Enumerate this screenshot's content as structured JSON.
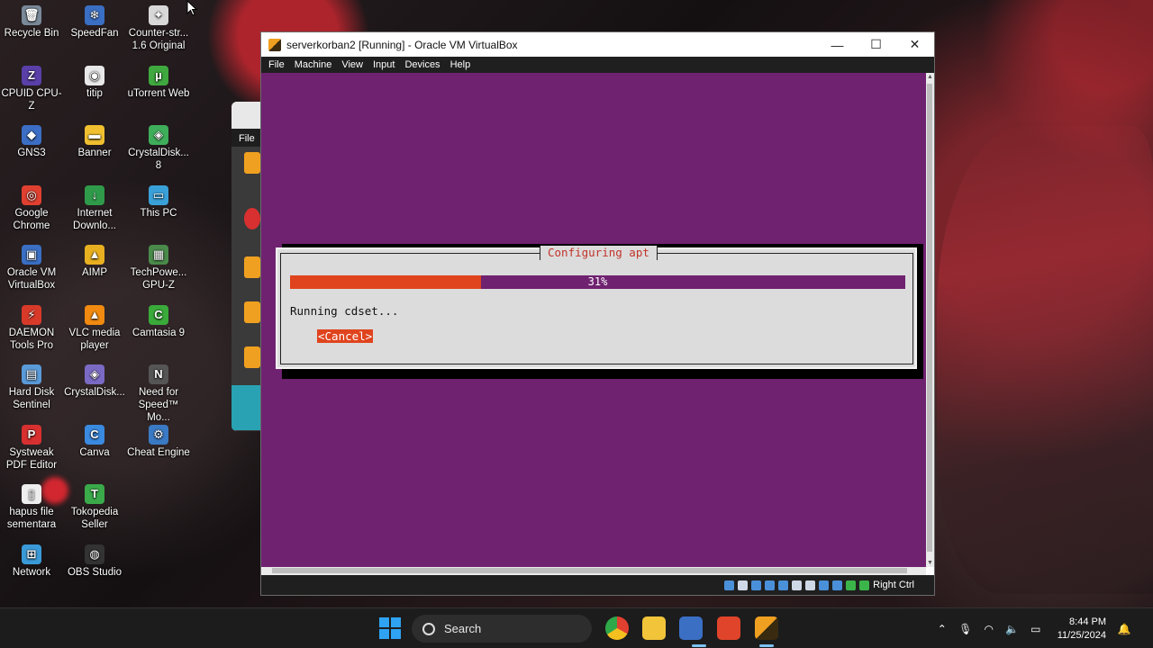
{
  "desktop": {
    "icons": [
      {
        "label": "Recycle Bin",
        "color": "#7a8a99",
        "glyph": "🗑"
      },
      {
        "label": "SpeedFan",
        "color": "#3a6fc4",
        "glyph": "❄"
      },
      {
        "label": "Counter-str... 1.6 Original",
        "color": "#d8d8d8",
        "glyph": "✦"
      },
      {
        "label": "CPUID CPU-Z",
        "color": "#5a3fa8",
        "glyph": "Z"
      },
      {
        "label": "titip",
        "color": "#e8e8e8",
        "glyph": "◉"
      },
      {
        "label": "uTorrent Web",
        "color": "#3fa83f",
        "glyph": "µ"
      },
      {
        "label": "GNS3",
        "color": "#3b6ec4",
        "glyph": "◆"
      },
      {
        "label": "Banner",
        "color": "#f0c030",
        "glyph": "▬"
      },
      {
        "label": "CrystalDisk... 8",
        "color": "#3fae5a",
        "glyph": "◈"
      },
      {
        "label": "Google Chrome",
        "color": "#e04030",
        "glyph": "◎"
      },
      {
        "label": "Internet Downlo...",
        "color": "#2f9a4a",
        "glyph": "↓"
      },
      {
        "label": "This PC",
        "color": "#3aa0d8",
        "glyph": "▭"
      },
      {
        "label": "Oracle VM VirtualBox",
        "color": "#3a6fc4",
        "glyph": "▣"
      },
      {
        "label": "AIMP",
        "color": "#e8b020",
        "glyph": "▲"
      },
      {
        "label": "TechPowe... GPU-Z",
        "color": "#4a8a4a",
        "glyph": "▦"
      },
      {
        "label": "DAEMON Tools Pro",
        "color": "#d83a2a",
        "glyph": "⚡"
      },
      {
        "label": "VLC media player",
        "color": "#f08a10",
        "glyph": "▲"
      },
      {
        "label": "Camtasia 9",
        "color": "#3aaa3a",
        "glyph": "C"
      },
      {
        "label": "Hard Disk Sentinel",
        "color": "#5a9ad8",
        "glyph": "▤"
      },
      {
        "label": "CrystalDisk...",
        "color": "#7a6ac4",
        "glyph": "◈"
      },
      {
        "label": "Need for Speed™ Mo...",
        "color": "#555555",
        "glyph": "N"
      },
      {
        "label": "Systweak PDF Editor",
        "color": "#d83030",
        "glyph": "P"
      },
      {
        "label": "Canva",
        "color": "#3a8ae0",
        "glyph": "C"
      },
      {
        "label": "Cheat Engine",
        "color": "#3a7ac4",
        "glyph": "⚙"
      },
      {
        "label": "hapus file sementara",
        "color": "#eeeeee",
        "glyph": "▯"
      },
      {
        "label": "Tokopedia Seller",
        "color": "#3aaa4a",
        "glyph": "T"
      },
      {
        "label": "",
        "color": "#000000",
        "glyph": ""
      },
      {
        "label": "Network",
        "color": "#3a9ad8",
        "glyph": "⊞"
      },
      {
        "label": "OBS Studio",
        "color": "#333333",
        "glyph": "◍"
      }
    ]
  },
  "behind_window": {
    "menu_label": "File"
  },
  "vm_window": {
    "title": "serverkorban2 [Running] - Oracle VM VirtualBox",
    "controls": {
      "minimize": "—",
      "maximize": "☐",
      "close": "✕"
    },
    "menu": [
      "File",
      "Machine",
      "View",
      "Input",
      "Devices",
      "Help"
    ],
    "host_key": "Right Ctrl"
  },
  "installer_dialog": {
    "title": "Configuring apt",
    "progress_percent": 31,
    "progress_label": "31%",
    "message": "Running cdset...",
    "cancel_label": "<Cancel>",
    "colors": {
      "background": "#6f2270",
      "accent": "#e0441e",
      "dialog": "#dcdcdc"
    }
  },
  "taskbar": {
    "search_placeholder": "Search",
    "time": "8:44 PM",
    "date": "11/25/2024"
  }
}
